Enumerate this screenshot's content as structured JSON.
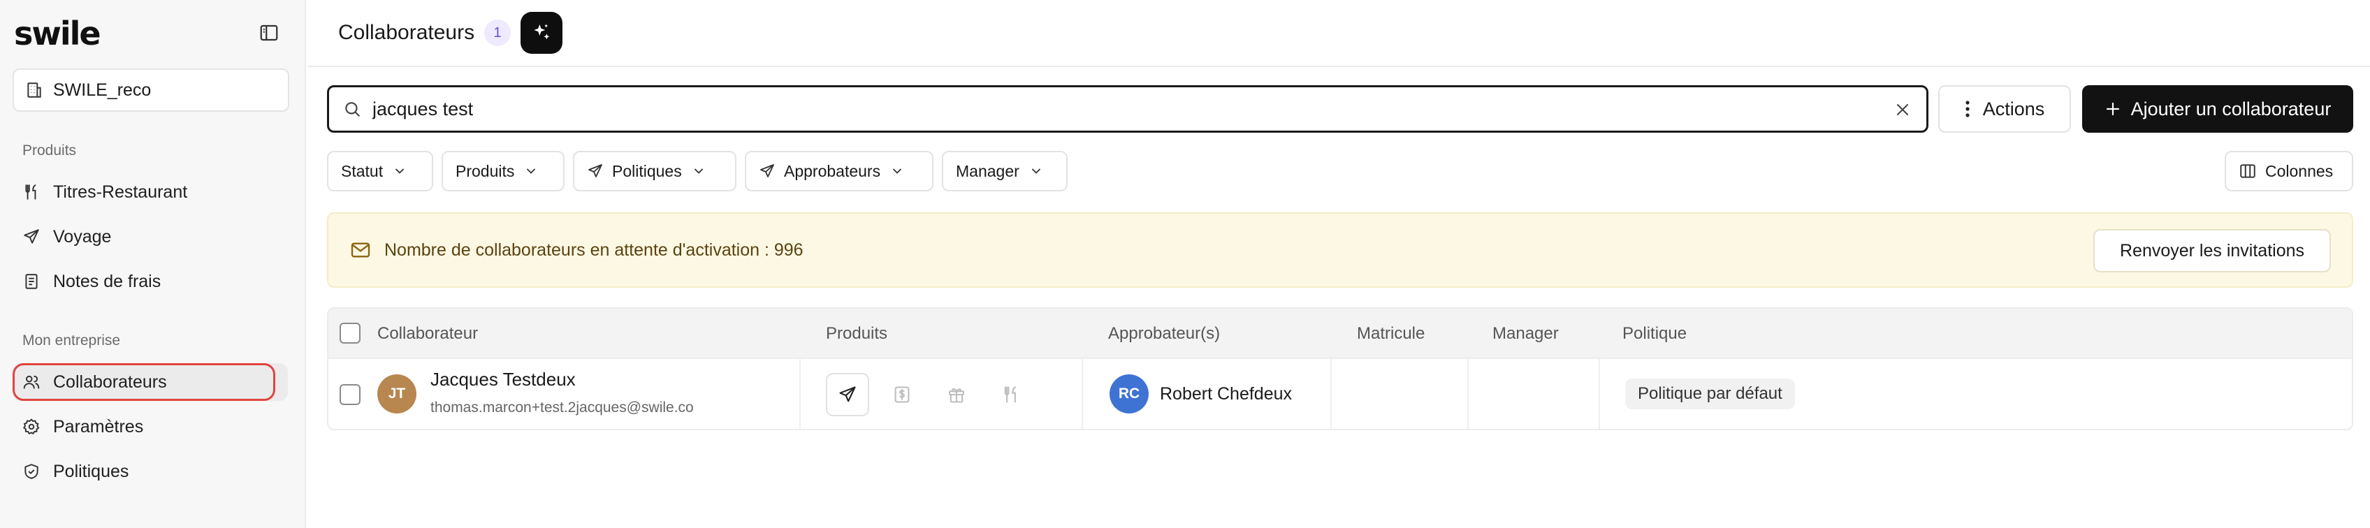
{
  "app": {
    "logo_text": "swile"
  },
  "sidebar": {
    "org": "SWILE_reco",
    "sections": [
      {
        "label": "Produits",
        "items": [
          {
            "label": "Titres-Restaurant",
            "icon": "utensils-icon"
          },
          {
            "label": "Voyage",
            "icon": "plane-icon"
          },
          {
            "label": "Notes de frais",
            "icon": "receipt-icon"
          }
        ]
      },
      {
        "label": "Mon entreprise",
        "items": [
          {
            "label": "Collaborateurs",
            "icon": "users-icon",
            "active": true
          },
          {
            "label": "Paramètres",
            "icon": "gear-icon"
          },
          {
            "label": "Politiques",
            "icon": "shield-check-icon"
          }
        ]
      }
    ]
  },
  "header": {
    "title": "Collaborateurs",
    "count": "1"
  },
  "toolbar": {
    "search_value": "jacques test",
    "actions_label": "Actions",
    "add_label": "Ajouter un collaborateur"
  },
  "filters": {
    "statut": "Statut",
    "produits": "Produits",
    "politiques": "Politiques",
    "approbateurs": "Approbateurs",
    "manager": "Manager",
    "colonnes": "Colonnes"
  },
  "banner": {
    "message": "Nombre de collaborateurs en attente d'activation : 996",
    "button": "Renvoyer les invitations"
  },
  "table": {
    "columns": [
      "Collaborateur",
      "Produits",
      "Approbateur(s)",
      "Matricule",
      "Manager",
      "Politique"
    ],
    "rows": [
      {
        "initials": "JT",
        "name": "Jacques Testdeux",
        "email": "thomas.marcon+test.2jacques@swile.co",
        "products": [
          "plane-icon",
          "dollar-card-icon",
          "gift-icon",
          "utensils-icon"
        ],
        "approver_initials": "RC",
        "approver_name": "Robert Chefdeux",
        "matricule": "",
        "manager": "",
        "policy": "Politique par défaut"
      }
    ]
  },
  "colors": {
    "accent_dark": "#121212",
    "badge_purple": "#6a4bd8",
    "banner_bg": "#fdf8e4",
    "active_outline": "#e0443e",
    "avatar_jt": "#b8864f",
    "avatar_rc": "#3f73d3"
  }
}
